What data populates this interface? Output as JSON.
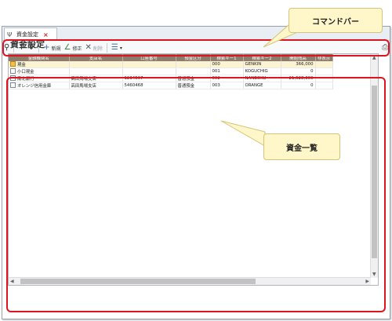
{
  "tab": {
    "title": "資金設定",
    "close": "×"
  },
  "toolbar": {
    "add_label": "新規",
    "edit_label": "修正",
    "delete_label": "削除"
  },
  "page": {
    "title": "資金設定"
  },
  "grid": {
    "columns": [
      "金融機関名",
      "支店名",
      "口座番号",
      "預金区分",
      "検索キー1",
      "検索キー2",
      "開始残高",
      "非表示"
    ],
    "rows": [
      {
        "name": "現金",
        "branch": "",
        "account": "",
        "type": "",
        "key1": "000",
        "key2": "GENKIN",
        "balance": "366,000",
        "hidden": ""
      },
      {
        "name": "小口現金",
        "branch": "",
        "account": "",
        "type": "",
        "key1": "001",
        "key2": "KOGUCHIG",
        "balance": "0",
        "hidden": ""
      },
      {
        "name": "南北銀行",
        "branch": "高田馬場支店",
        "account": "1234567",
        "type": "普通預金",
        "key1": "002",
        "key2": "NANBOKU",
        "balance": "21,528,000",
        "hidden": ""
      },
      {
        "name": "オレンジ信用金庫",
        "branch": "高田馬場支店",
        "account": "5460468",
        "type": "普通預金",
        "key1": "003",
        "key2": "ORANGE",
        "balance": "0",
        "hidden": ""
      }
    ]
  },
  "callouts": {
    "command_bar": "コマンドバー",
    "fund_list": "資金一覧"
  },
  "colors": {
    "highlight": "#e0141e",
    "callout_bg": "#fff6c9",
    "header_bg": "#8b7c6c"
  }
}
